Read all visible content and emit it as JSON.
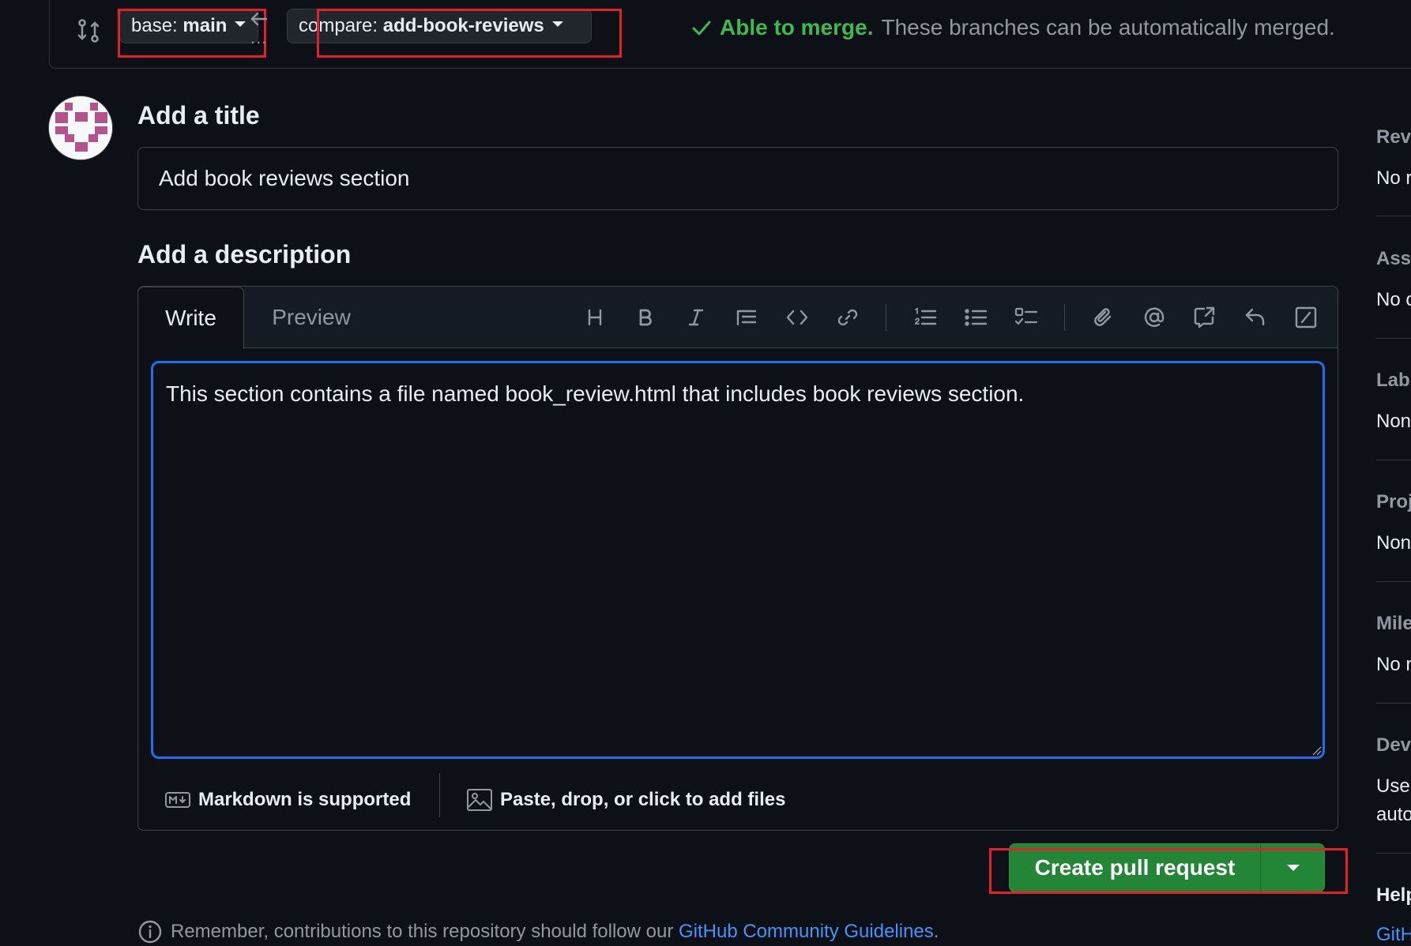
{
  "compare_bar": {
    "base_label": "base:",
    "base_value": "main",
    "compare_label": "compare:",
    "compare_value": "add-book-reviews",
    "swap_dots": "...",
    "merge_ok": "Able to merge.",
    "merge_message": "These branches can be automatically merged."
  },
  "form": {
    "title_heading": "Add a title",
    "title_value": "Add book reviews section",
    "description_heading": "Add a description",
    "description_value": "This section contains a file named book_review.html that includes book reviews section.",
    "tabs": {
      "write": "Write",
      "preview": "Preview"
    },
    "toolbar_icons": [
      "heading-icon",
      "bold-icon",
      "italic-icon",
      "quote-icon",
      "code-icon",
      "link-icon",
      "ordered-list-icon",
      "unordered-list-icon",
      "task-list-icon",
      "attach-icon",
      "mention-icon",
      "reference-icon",
      "undo-icon",
      "slash-commands-icon"
    ],
    "markdown_note": "Markdown is supported",
    "files_note": "Paste, drop, or click to add files",
    "create_button": "Create pull request"
  },
  "footer": {
    "remember_text": "Remember, contributions to this repository should follow our",
    "guidelines_link": "GitHub Community Guidelines",
    "period": "."
  },
  "sidebar": {
    "sections": [
      {
        "heading": "Rev",
        "value": "No r"
      },
      {
        "heading": "Ass",
        "value": "No o"
      },
      {
        "heading": "Lab",
        "value": "Non"
      },
      {
        "heading": "Proj",
        "value": "Non"
      },
      {
        "heading": "Mile",
        "value": "No r"
      },
      {
        "heading": "Dev",
        "value": "Use",
        "value2": "auto"
      },
      {
        "heading": "Help",
        "value": "GitH"
      }
    ]
  },
  "colors": {
    "background": "#0d1117",
    "accent_blue": "#1f6feb",
    "success_green": "#3fb950",
    "button_green": "#238636",
    "highlight_red": "#e3202a"
  }
}
